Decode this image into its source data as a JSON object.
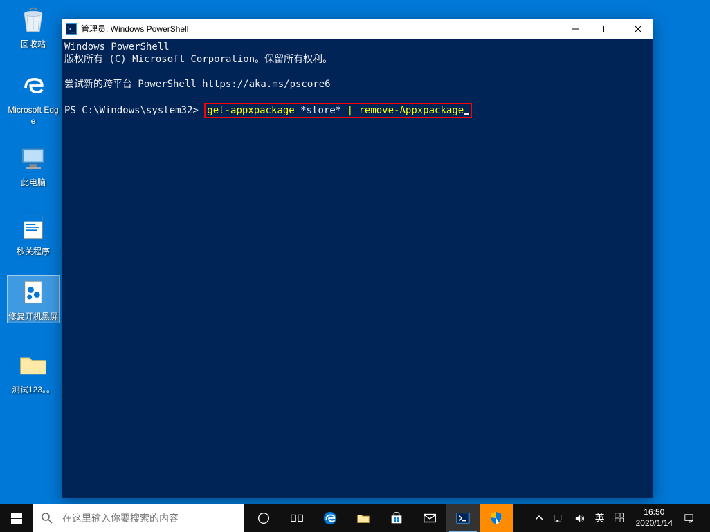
{
  "desktop": {
    "icons": [
      {
        "label": "回收站",
        "name": "recycle-bin"
      },
      {
        "label": "Microsoft Edge",
        "name": "edge"
      },
      {
        "label": "此电脑",
        "name": "this-pc"
      },
      {
        "label": "秒关程序",
        "name": "quick-close"
      },
      {
        "label": "修复开机黑屏",
        "name": "fix-boot",
        "selected": true
      },
      {
        "label": "测试123。。",
        "name": "test-folder"
      }
    ]
  },
  "window": {
    "title": "管理员: Windows PowerShell",
    "lines": {
      "l1": "Windows PowerShell",
      "l2": "版权所有 (C) Microsoft Corporation。保留所有权利。",
      "l3": "尝试新的跨平台 PowerShell https://aka.ms/pscore6",
      "prompt": "PS C:\\Windows\\system32> ",
      "cmd_part1": "get-appxpackage ",
      "cmd_part2": "*store* ",
      "cmd_pipe": "|",
      "cmd_part3": " remove-Appxpackage"
    }
  },
  "taskbar": {
    "search_placeholder": "在这里输入你要搜索的内容",
    "ime": "英",
    "time": "16:50",
    "date": "2020/1/14"
  }
}
